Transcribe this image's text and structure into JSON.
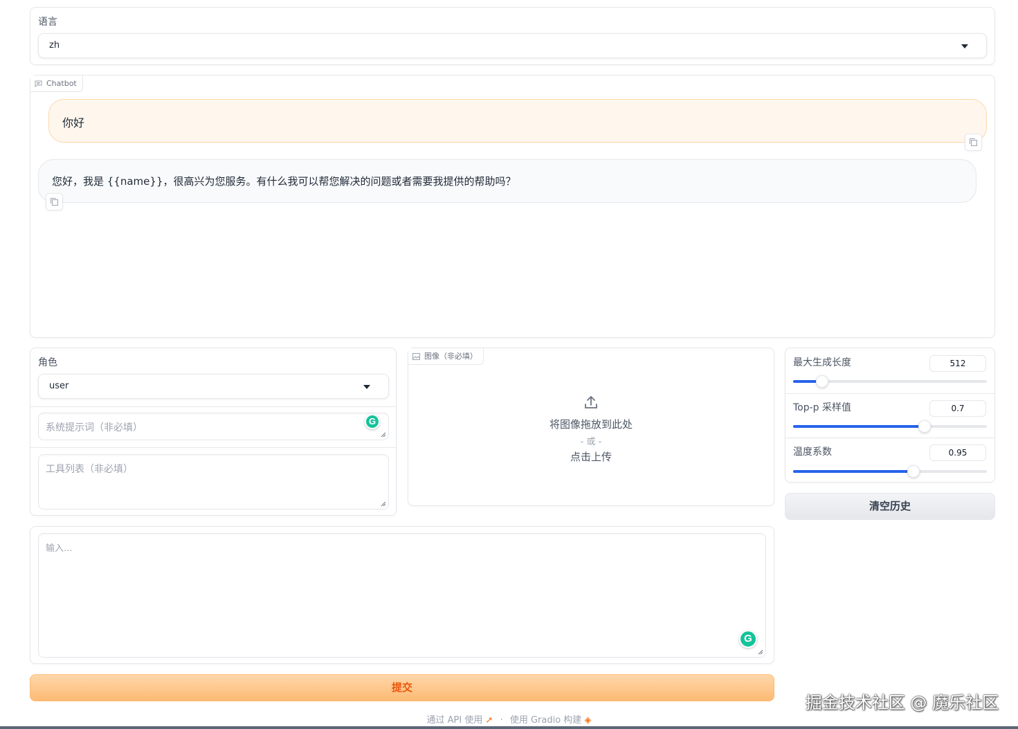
{
  "language": {
    "label": "语言",
    "value": "zh"
  },
  "chatbot": {
    "label": "Chatbot",
    "messages": [
      {
        "role": "user",
        "text": "你好"
      },
      {
        "role": "assistant",
        "text": "您好，我是 {{name}}，很高兴为您服务。有什么我可以帮您解决的问题或者需要我提供的帮助吗？"
      }
    ]
  },
  "role": {
    "label": "角色",
    "value": "user"
  },
  "system_prompt": {
    "placeholder": "系统提示词（非必填）"
  },
  "tools": {
    "placeholder": "工具列表（非必填）"
  },
  "image": {
    "label": "图像（非必填）",
    "drop_text": "将图像拖放到此处",
    "or_text": "- 或 -",
    "click_text": "点击上传"
  },
  "sliders": [
    {
      "label": "最大生成长度",
      "value": "512",
      "fraction": 0.15
    },
    {
      "label": "Top-p 采样值",
      "value": "0.7",
      "fraction": 0.68
    },
    {
      "label": "温度系数",
      "value": "0.95",
      "fraction": 0.62
    }
  ],
  "clear_button": "清空历史",
  "input": {
    "placeholder": "输入..."
  },
  "submit_button": "提交",
  "footer": {
    "api_text": "通过 API 使用",
    "separator": "·",
    "built_text": "使用 Gradio 构建"
  },
  "watermark": "掘金技术社区 @ 魔乐社区",
  "colors": {
    "accent": "#2563eb",
    "submit_bg": "#fdba74",
    "submit_text": "#ea580c",
    "user_bubble": "#fff7ed",
    "bot_bubble": "#f9fafb"
  }
}
